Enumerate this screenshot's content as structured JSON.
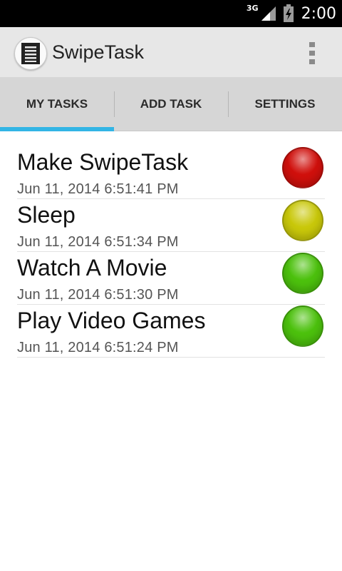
{
  "status_bar": {
    "network": "3G",
    "time": "2:00"
  },
  "action_bar": {
    "title": "SwipeTask",
    "icon": "list-icon",
    "overflow_icon": "overflow-menu-icon"
  },
  "tabs": [
    {
      "label": "MY TASKS",
      "selected": true
    },
    {
      "label": "ADD TASK",
      "selected": false
    },
    {
      "label": "SETTINGS",
      "selected": false
    }
  ],
  "tasks": [
    {
      "title": "Make SwipeTask",
      "date": "Jun 11, 2014 6:51:41 PM",
      "priority": "red"
    },
    {
      "title": "Sleep",
      "date": "Jun 11, 2014 6:51:34 PM",
      "priority": "yellow"
    },
    {
      "title": "Watch A Movie",
      "date": "Jun 11, 2014 6:51:30 PM",
      "priority": "green"
    },
    {
      "title": "Play Video Games",
      "date": "Jun 11, 2014 6:51:24 PM",
      "priority": "green"
    }
  ],
  "colors": {
    "accent": "#33b5e5",
    "red": "#d0100c",
    "yellow": "#c9c80a",
    "green": "#4cc10d"
  }
}
